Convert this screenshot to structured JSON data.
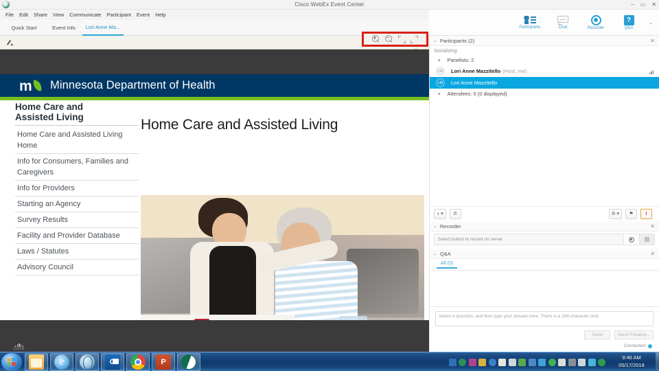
{
  "window": {
    "title": "Cisco WebEx Event Center",
    "logo_icon": "webex-logo-icon",
    "minimize": "–",
    "maximize": "▭",
    "close": "✕"
  },
  "menubar": {
    "items": [
      "File",
      "Edit",
      "Share",
      "View",
      "Communicate",
      "Participant",
      "Event",
      "Help"
    ]
  },
  "tabs": [
    {
      "label": "Quick Start",
      "active": false
    },
    {
      "label": "Event Info",
      "active": false
    },
    {
      "label": "Lori Anne Ma...",
      "active": true
    }
  ],
  "dock_toolbar": {
    "buttons": [
      {
        "label": "Participants",
        "icon": "participants-icon"
      },
      {
        "label": "Chat",
        "icon": "chat-icon"
      },
      {
        "label": "Recorder",
        "icon": "recorder-icon"
      },
      {
        "label": "Q&A",
        "icon": "qa-icon",
        "glyph": "?"
      }
    ],
    "overflow_glyph": "⌄"
  },
  "slide_toolbar": {
    "annotate_icon": "pencil-icon",
    "zoom_tools": [
      {
        "name": "zoom-in-icon",
        "title": "Zoom In"
      },
      {
        "name": "zoom-out-icon",
        "title": "Zoom Out"
      },
      {
        "name": "fit-to-page-icon",
        "title": "Fit to Page"
      },
      {
        "name": "expand-view-icon",
        "title": "Expand"
      }
    ],
    "highlight_color": "#d8201a",
    "arrow_color": "#f8b22a"
  },
  "slide": {
    "brand_bar": {
      "logo_text": "m",
      "organization": "Minnesota Department of Health",
      "navy": "#003865",
      "green": "#78be20"
    },
    "sidebar": {
      "section_title_line1": "Home Care and",
      "section_title_line2": "Assisted Living",
      "items": [
        "Home Care and Assisted Living Home",
        "Info for Consumers, Families and Caregivers",
        "Info for Providers",
        "Starting an Agency",
        "Survey Results",
        "Facility and Provider Database",
        "Laws / Statutes",
        "Advisory Council"
      ]
    },
    "page_title": "Home Care and Assisted Living",
    "photo_alt": "Caregiver assisting an older woman on a couch",
    "footer_logo": {
      "wordmark": "cisco",
      "icon": "cisco-bars-icon"
    }
  },
  "participants_panel": {
    "title": "Participants (2)",
    "collapse_glyph": "⌄",
    "close_glyph": "✕",
    "status_text": "Socializing",
    "groups": [
      {
        "label": "Panelists: 2",
        "toggle_glyph": "▾",
        "rows": [
          {
            "initials": "LM",
            "name": "Lori Anne Mazzitello",
            "meta": "(Host, me)",
            "selected": false,
            "signal_icon": "signal-bars-icon"
          },
          {
            "initials": "LM",
            "name": "Lori Anne Mazzitello",
            "meta": "",
            "selected": true,
            "signal_icon": ""
          }
        ]
      },
      {
        "label": "Attendees: 0 (0 displayed)",
        "toggle_glyph": "▾",
        "rows": []
      }
    ],
    "tools": [
      {
        "name": "audio-mute-toggle",
        "glyph": "◖",
        "state": "on"
      },
      {
        "name": "phone-button",
        "glyph": "✆",
        "state": "off"
      },
      {
        "name": "make-presenter-button",
        "glyph": "✇",
        "state": "off"
      },
      {
        "name": "assign-privileges-button",
        "glyph": "⚑",
        "state": "off"
      },
      {
        "name": "raise-hand-button",
        "glyph": "!",
        "state": "alert"
      }
    ]
  },
  "recorder_panel": {
    "title": "Recorder",
    "collapse_glyph": "⌄",
    "close_glyph": "✕",
    "status_text": "Select button to record on server",
    "record_icon": "record-circle-icon",
    "stop_icon": "stop-square-icon"
  },
  "qa_panel": {
    "title": "Q&A",
    "collapse_glyph": "⌄",
    "close_glyph": "✕",
    "tabs": [
      {
        "label": "All (0)",
        "active": true
      }
    ],
    "answer_placeholder": "Select a question, and then type your answer here. There is a 256-character limit.",
    "send_label": "Send",
    "send_privately_label": "Send Privately...",
    "connection_status": "Connected",
    "connection_color": "#2bb3d6"
  },
  "taskbar": {
    "start_icon": "windows-start-orb-icon",
    "apps": [
      {
        "name": "file-explorer-icon",
        "label": "Windows Explorer"
      },
      {
        "name": "internet-explorer-icon",
        "label": "Internet Explorer",
        "glyph": "e"
      },
      {
        "name": "globe-app-icon",
        "label": "Browser"
      },
      {
        "name": "outlook-icon",
        "label": "Microsoft Outlook",
        "glyph": "O"
      },
      {
        "name": "chrome-icon",
        "label": "Google Chrome"
      },
      {
        "name": "powerpoint-icon",
        "label": "Microsoft PowerPoint",
        "glyph": "P"
      },
      {
        "name": "webex-icon",
        "label": "Cisco WebEx"
      }
    ],
    "tray_icons": [
      "tray-icon-1",
      "tray-icon-2",
      "tray-icon-3",
      "tray-icon-4",
      "tray-icon-5",
      "tray-mail-icon",
      "tray-network-icon",
      "tray-monitor-icon",
      "tray-icon-9",
      "tray-icon-10",
      "tray-icon-11",
      "tray-icon-12",
      "tray-icon-13",
      "tray-volume-icon",
      "tray-icon-15",
      "tray-sync-icon"
    ],
    "clock_time": "9:46 AM",
    "clock_date": "05/17/2018"
  }
}
